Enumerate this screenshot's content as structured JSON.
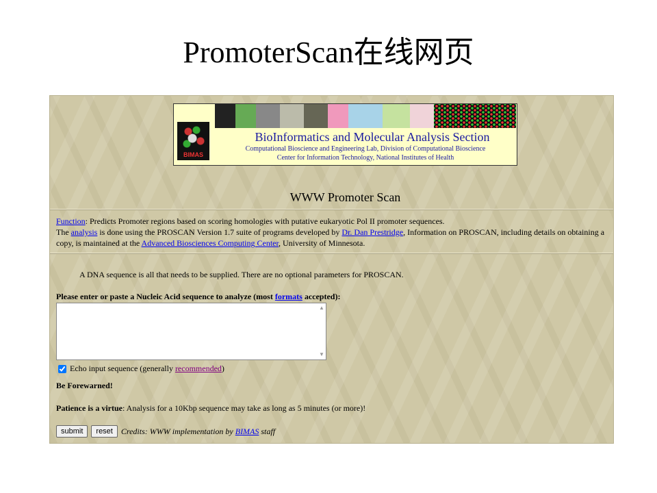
{
  "slide": {
    "title": "PromoterScan在线网页"
  },
  "banner": {
    "logo_text": "BIMAS",
    "title": "BioInformatics and Molecular Analysis Section",
    "line1": "Computational Bioscience and Engineering Lab, Division of Computational Bioscience",
    "line2": "Center for Information Technology, National Institutes of Health"
  },
  "page": {
    "heading": "WWW Promoter Scan",
    "function_link": "Function",
    "function_text": ": Predicts Promoter regions based on scoring homologies with putative eukaryotic Pol II promoter sequences.",
    "the": "The ",
    "analysis_link": "analysis",
    "analysis_text": " is done using the PROSCAN Version 1.7 suite of programs developed by ",
    "author_link": "Dr. Dan Prestridge",
    "info_text": ", Information on PROSCAN, including details on obtaining a copy, is maintained at the ",
    "center_link": "Advanced Biosciences Computing Center",
    "university_text": ", University of Minnesota.",
    "dna_note": "A DNA sequence is all that needs to be supplied. There are no optional parameters for PROSCAN.",
    "form_label_before": "Please enter or paste a Nucleic Acid sequence to analyze (most ",
    "formats_link": "formats",
    "form_label_after": " accepted):",
    "sequence_value": "",
    "echo_label": "Echo input sequence (generally ",
    "recommended_link": "recommended",
    "echo_close": ")",
    "echo_checked": true,
    "forewarned": "Be Forewarned!",
    "patience_bold": "Patience is a virtue",
    "patience_text": ": Analysis for a 10Kbp sequence may take as long as 5 minutes (or more)!",
    "submit_label": "submit",
    "reset_label": "reset",
    "credits_text": "Credits: WWW implementation by ",
    "credits_link": "BIMAS",
    "credits_after": " staff"
  },
  "colors": {
    "background": "#cfc8a6",
    "banner_bg": "#ffffc8",
    "link": "#0000ee",
    "visited_link": "#800080",
    "banner_text": "#1a1aa0"
  }
}
